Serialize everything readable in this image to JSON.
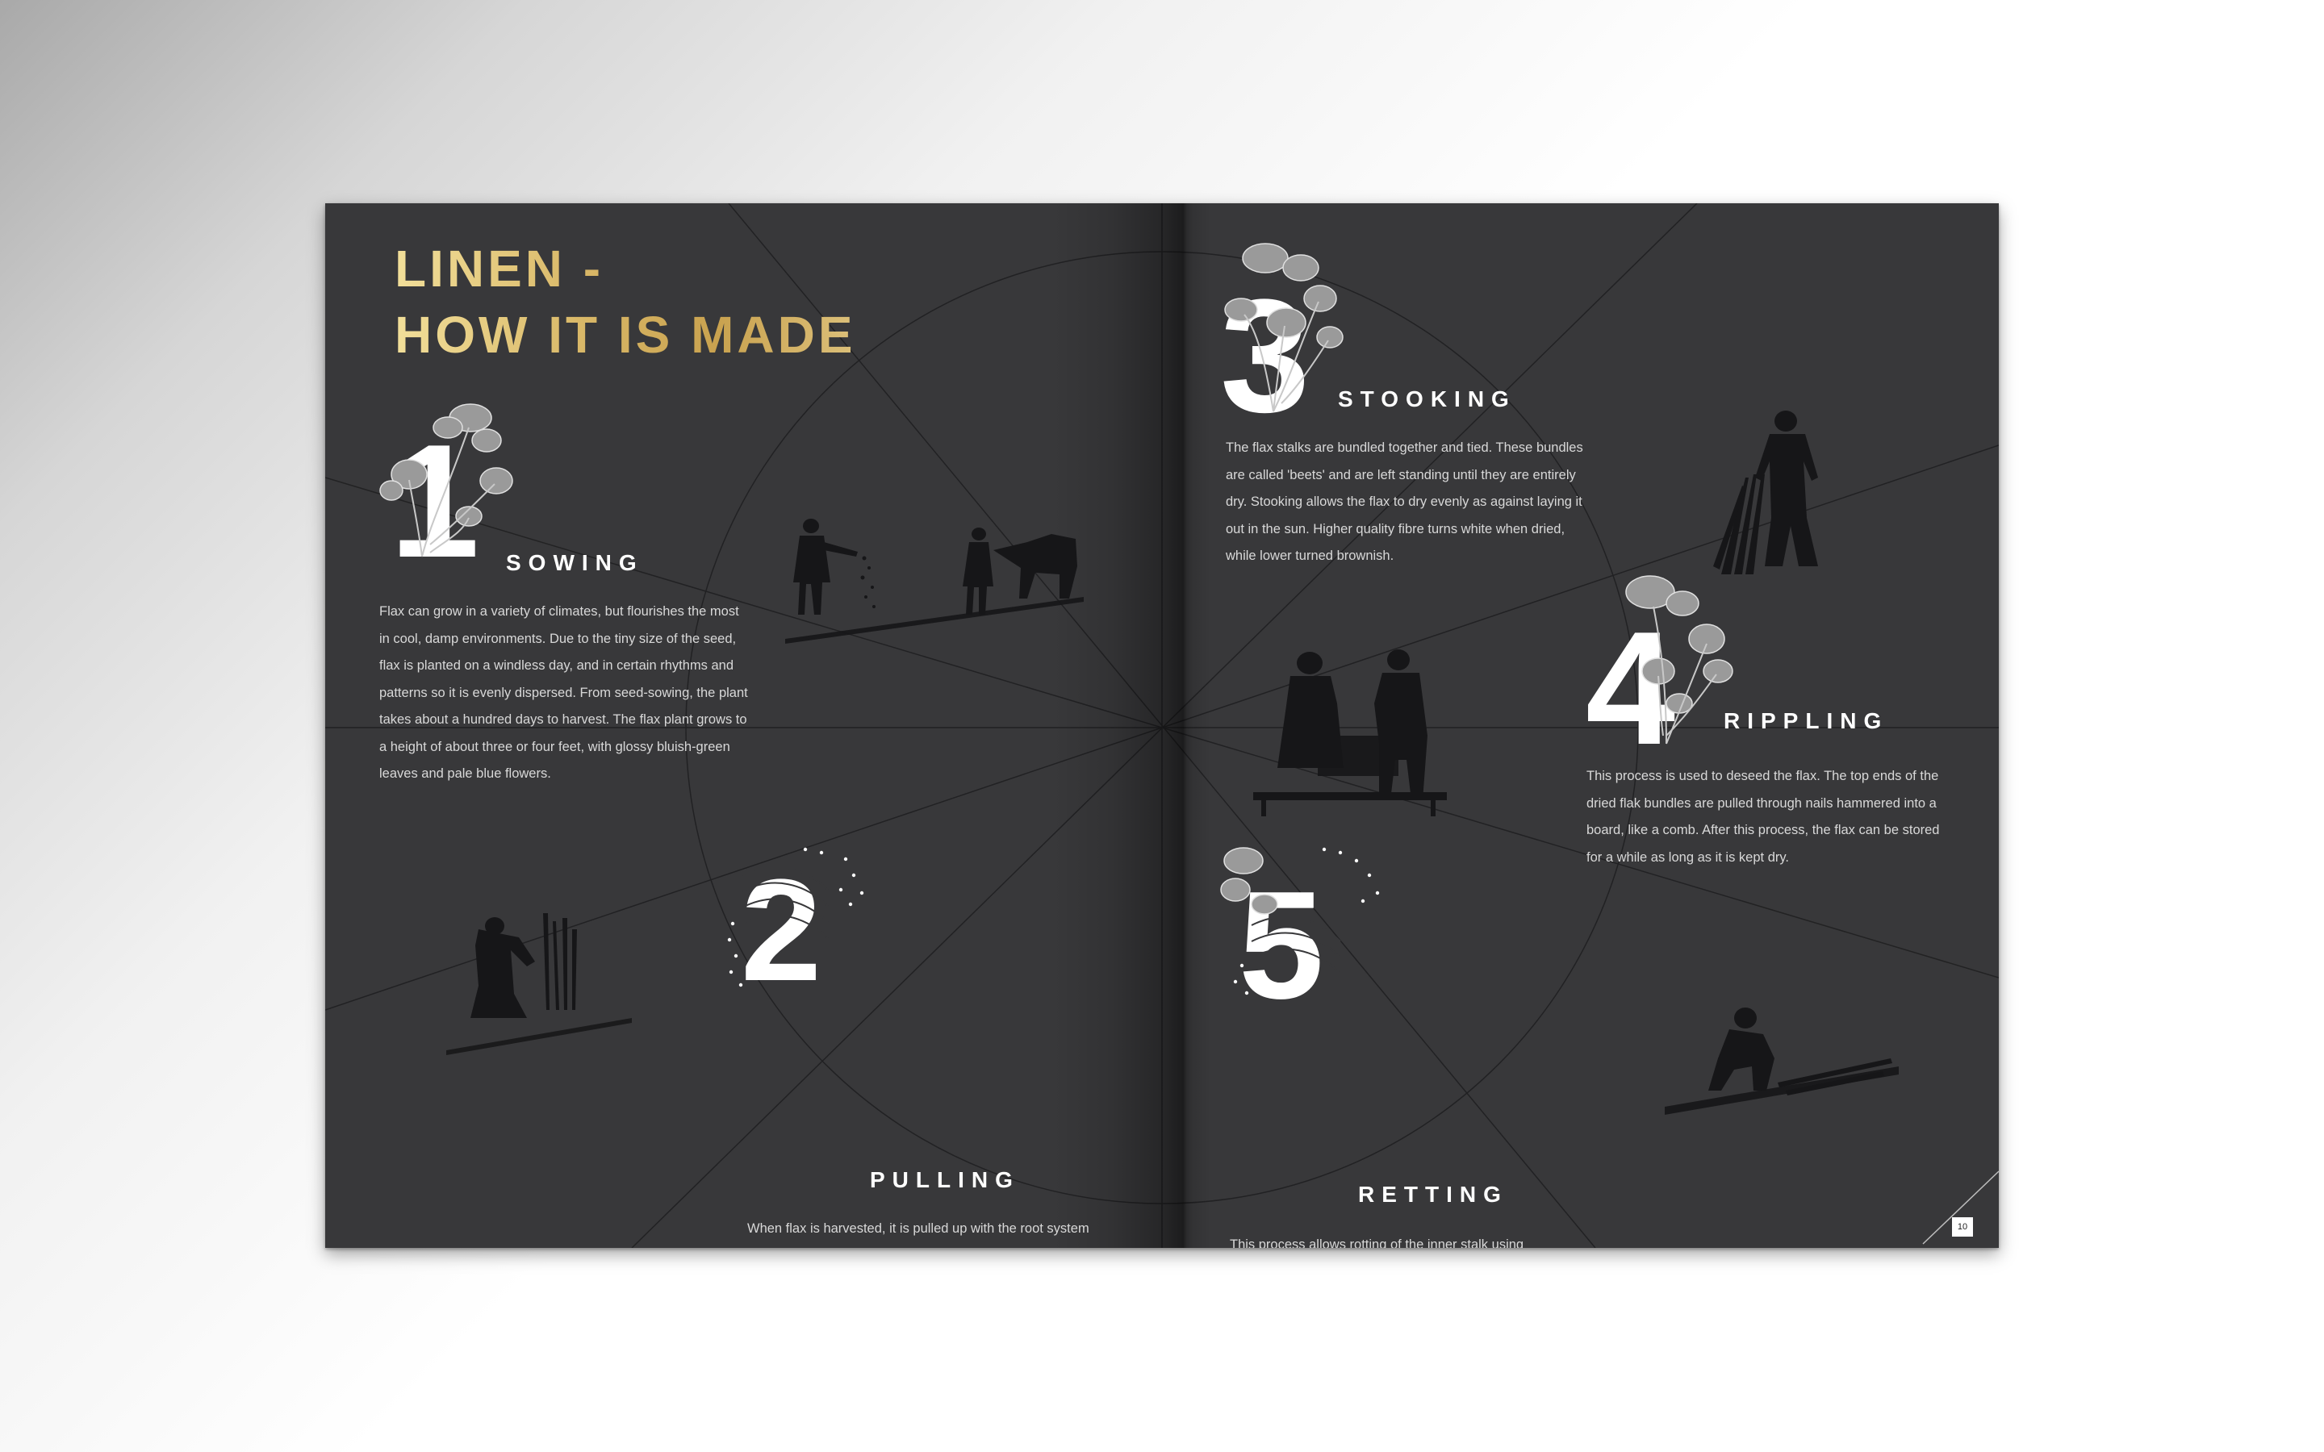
{
  "document": {
    "title_line1": "LINEN -",
    "title_line2": "HOW IT IS MADE",
    "page_number": "10",
    "colors": {
      "page_background": "#38383a",
      "title_gold": "#d9b865",
      "heading": "#ffffff",
      "body_text": "#d8d8d8"
    }
  },
  "steps": [
    {
      "number": "1",
      "heading": "SOWING",
      "illustration": "sower-and-plough-engraving",
      "body": "Flax can grow in a variety of climates, but flourishes the most in cool, damp environments. Due to the tiny size of the seed, flax is planted on a windless day, and in certain rhythms and patterns so it is evenly dispersed. From seed-sowing, the plant takes about a hundred days to harvest. The flax plant grows to a height of about three or four feet, with glossy bluish-green leaves and pale blue flowers."
    },
    {
      "number": "2",
      "heading": "PULLING",
      "illustration": "woman-pulling-flax-engraving",
      "body": "When flax is harvested, it is pulled up with the root system somewhat intact, rather than cut at the base. This method maximizes the quality of the fibre in several ways. First, it increases the length of fibre. Second, it prevents the plant sap from leaking out of the cut stalk, in turn allowing the plant to withstand longer period of stoking, which ultimately yields better quality fabric."
    },
    {
      "number": "3",
      "heading": "STOOKING",
      "illustration": "man-with-sheaf-engraving",
      "body": "The flax stalks are bundled together and tied. These bundles are called 'beets' and are left standing until they are entirely dry. Stooking allows the flax to dry evenly as against laying it out in the sun. Higher quality fibre turns white when dried, while lower turned brownish."
    },
    {
      "number": "4",
      "heading": "RIPPLING",
      "illustration": "two-women-rippling-engraving",
      "body": "This process is used to deseed the flax. The top ends of the dried flak bundles are pulled through nails hammered into a board, like a comb. After this process, the flax can be stored for a while as long as it is kept dry."
    },
    {
      "number": "5",
      "heading": "RETTING",
      "illustration": "person-spreading-flax-engraving",
      "body": "This process allows rotting of the inner stalk using bacteria, leaving the outer fibres intact. The process decomposes the pectin, which binds the stalk and fibres together, allowing the fibres to be freed from the stalk without damaging them."
    }
  ]
}
